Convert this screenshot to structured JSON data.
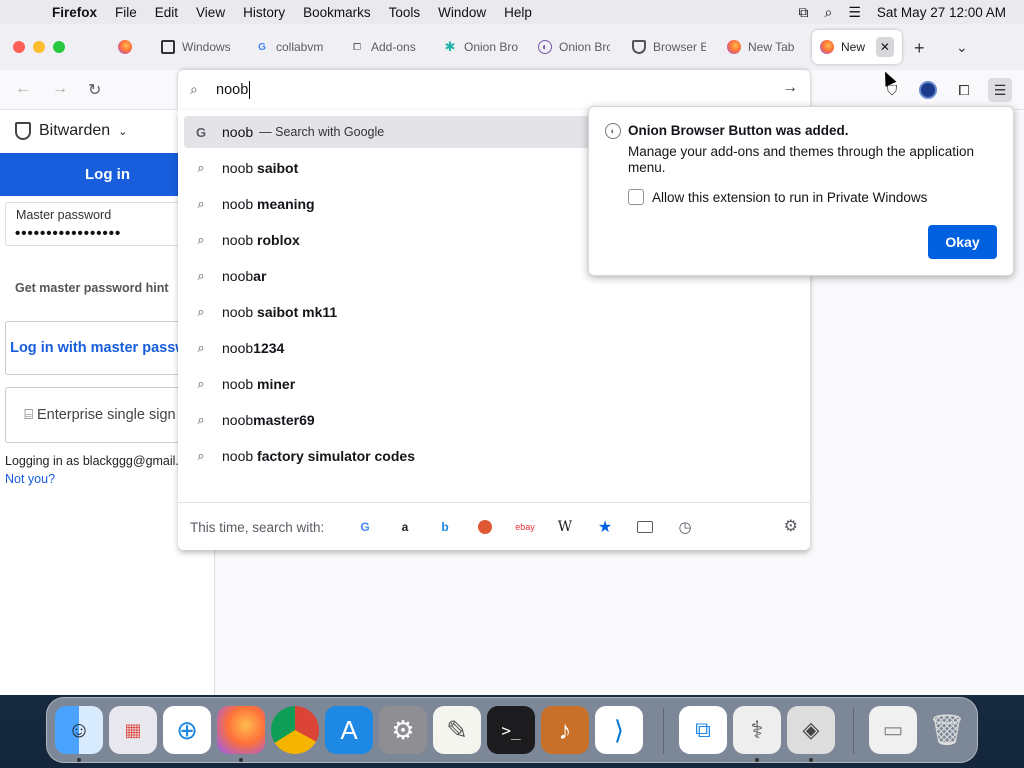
{
  "menubar": {
    "app": "Firefox",
    "items": [
      "File",
      "Edit",
      "View",
      "History",
      "Bookmarks",
      "Tools",
      "Window",
      "Help"
    ],
    "clock": "Sat May 27  12:00 AM"
  },
  "tabs": [
    {
      "label": "Windows",
      "icon": "book-icon"
    },
    {
      "label": "collabvm",
      "icon": "google-icon"
    },
    {
      "label": "Add-ons",
      "icon": "puzzle-icon"
    },
    {
      "label": "Onion Bro",
      "icon": "onion-star-icon"
    },
    {
      "label": "Onion Bro",
      "icon": "onion-icon"
    },
    {
      "label": "Browser E",
      "icon": "shield-icon"
    },
    {
      "label": "New Tab",
      "icon": "firefox-icon"
    },
    {
      "label": "New T",
      "icon": "firefox-icon",
      "active": true
    }
  ],
  "urlbar": {
    "value": "noob"
  },
  "suggestions": [
    {
      "prefix": "noob",
      "bold": "",
      "sub": "— Search with Google",
      "type": "google"
    },
    {
      "prefix": "noob ",
      "bold": "saibot"
    },
    {
      "prefix": "noob ",
      "bold": "meaning"
    },
    {
      "prefix": "noob ",
      "bold": "roblox"
    },
    {
      "prefix": "noob",
      "bold": "ar"
    },
    {
      "prefix": "noob ",
      "bold": "saibot mk11"
    },
    {
      "prefix": "noob",
      "bold": "1234"
    },
    {
      "prefix": "noob ",
      "bold": "miner"
    },
    {
      "prefix": "noob",
      "bold": "master69"
    },
    {
      "prefix": "noob ",
      "bold": "factory simulator codes"
    }
  ],
  "oneoff": {
    "label": "This time, search with:",
    "engines": [
      "google",
      "amazon",
      "bing",
      "duckduckgo",
      "ebay",
      "wikipedia",
      "bookmarks",
      "tabs",
      "history"
    ]
  },
  "sidebar": {
    "title": "Bitwarden",
    "login_header": "Log in",
    "master_label": "Master password",
    "master_value": "•••••••••••••••••",
    "hint": "Get master password hint",
    "btn_master": "Log in with master password",
    "btn_sso": "Enterprise single sign on",
    "logged_in": "Logging in as blackggg@gmail.c",
    "not_you": "Not you?"
  },
  "panel": {
    "title": "Onion Browser Button was added.",
    "message": "Manage your add-ons and themes through the application menu.",
    "checkbox": "Allow this extension to run in Private Windows",
    "okay": "Okay"
  },
  "colors": {
    "accent": "#0061e0",
    "bitwarden": "#175ddc"
  }
}
